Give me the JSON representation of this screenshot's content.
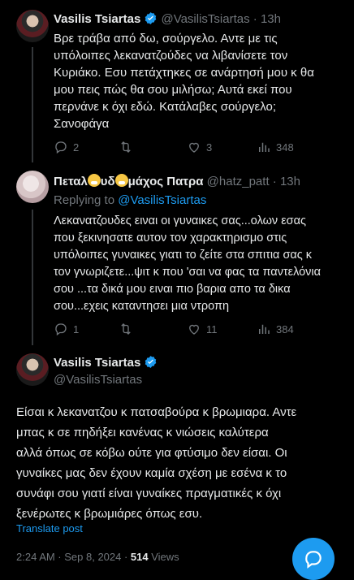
{
  "tweet1": {
    "author_name": "Vasilis Tsiartas",
    "handle": "@VasilisTsiartas",
    "dot": "·",
    "time": "13h",
    "text_lines": [
      "Βρε τράβα από δω, σούργελο. Αντε με τις",
      "υπόλοιπες λεκανατζούδες να λιβανίσετε τον",
      "Κυριάκο. Εσυ πετάχτηκες σε ανάρτησή μου κ θα",
      "μου πεις πώς θα σου μιλήσω; Αυτά εκεί που",
      "περνάνε κ όχι εδώ. Κατάλαβες σούργελο;",
      "Σανοφάγα"
    ],
    "replies": "2",
    "likes": "3",
    "views": "348"
  },
  "tweet2": {
    "author_name_parts": [
      "Πεταλ",
      "υδ",
      "μάχος Πατρα"
    ],
    "handle": "@hatz_patt",
    "dot": "·",
    "time": "13h",
    "replying_prefix": "Replying to ",
    "replying_to": "@VasilisTsiartas",
    "text_lines": [
      "Λεκανατζουδες ειναι οι γυναικες σας...ολων εσας",
      "που ξεκινησατε αυτον τον χαρακτηρισμο στις",
      "υπόλοιπες γυναικες γιατι το ζείτε στα σπιτια σας κ",
      "τον γνωριζετε...ψιτ κ που 'σαι να φας τα παντελόνια",
      "σου ...τα δικά μου ειναι πιο βαρια απο τα δικα",
      "σου...εχεις καταντησει μια ντροπη"
    ],
    "replies": "1",
    "likes": "11",
    "views": "384"
  },
  "tweet3": {
    "author_name": "Vasilis Tsiartas",
    "handle": "@VasilisTsiartas",
    "text_lines": [
      "Είσαι κ λεκανατζου κ πατσαβούρα κ βρωμιαρα. Αντε",
      "μπας κ σε πηδήξει κανένας κ νιώσεις καλύτερα",
      "αλλά όπως σε κόβω ούτε για φτύσιμο δεν είσαι. Οι",
      "γυναίκες μας δεν έχουν καμία σχέση με εσένα κ το",
      "συνάφι σου γιατί είναι γυναίκες πραγματικές κ όχι",
      "ξενέρωτες κ βρωμιάρες όπως εσυ."
    ],
    "translate": "Translate post",
    "meta_time": "2:24 AM · Sep 8, 2024 · ",
    "meta_views_count": "514",
    "meta_views_label": " Views"
  },
  "colors": {
    "accent": "#1d9bf0",
    "muted": "#71767b",
    "text": "#e7e9ea",
    "bg": "#000000"
  }
}
